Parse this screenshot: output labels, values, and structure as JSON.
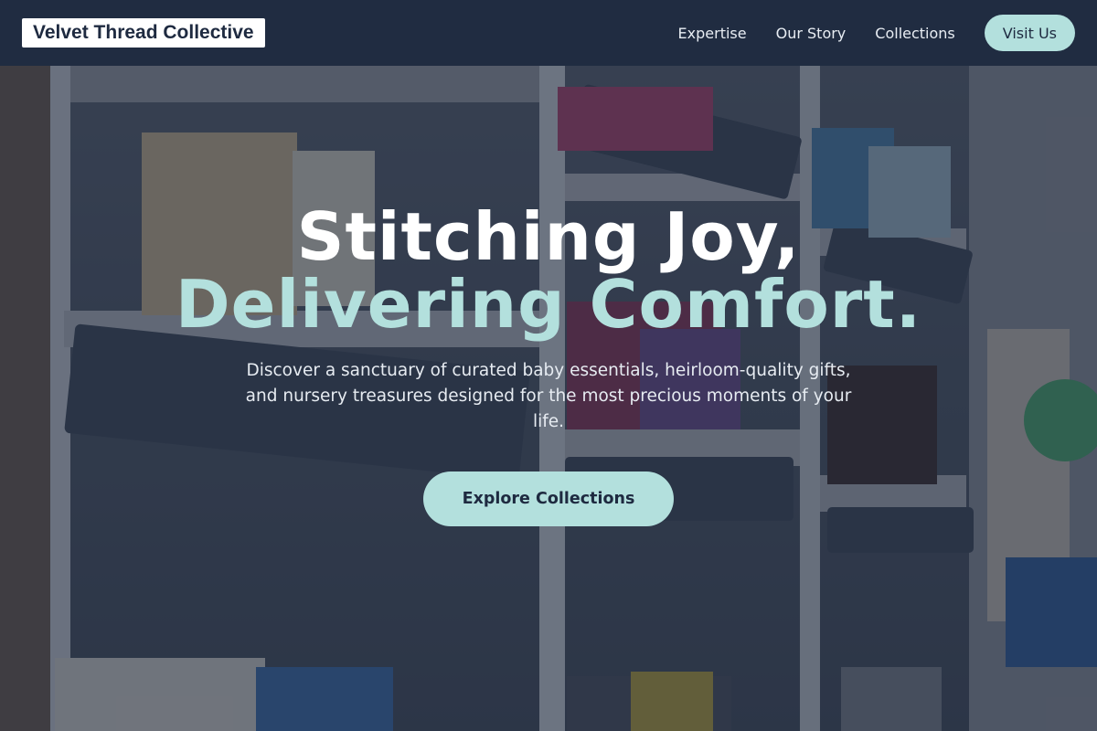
{
  "brand": {
    "name": "Velvet Thread Collective"
  },
  "nav": {
    "links": [
      "Expertise",
      "Our Story",
      "Collections"
    ],
    "cta_label": "Visit Us"
  },
  "hero": {
    "headline_line1": "Stitching Joy,",
    "headline_line2": "Delivering Comfort.",
    "subtitle": "Discover a sanctuary of curated baby essentials, heirloom-quality gifts, and nursery treasures designed for the most precious moments of your life.",
    "cta_label": "Explore Collections"
  },
  "theme": {
    "accent": "#b3e0dd",
    "nav_bg": "#1e2a40",
    "text_dark": "#1e2a40"
  }
}
